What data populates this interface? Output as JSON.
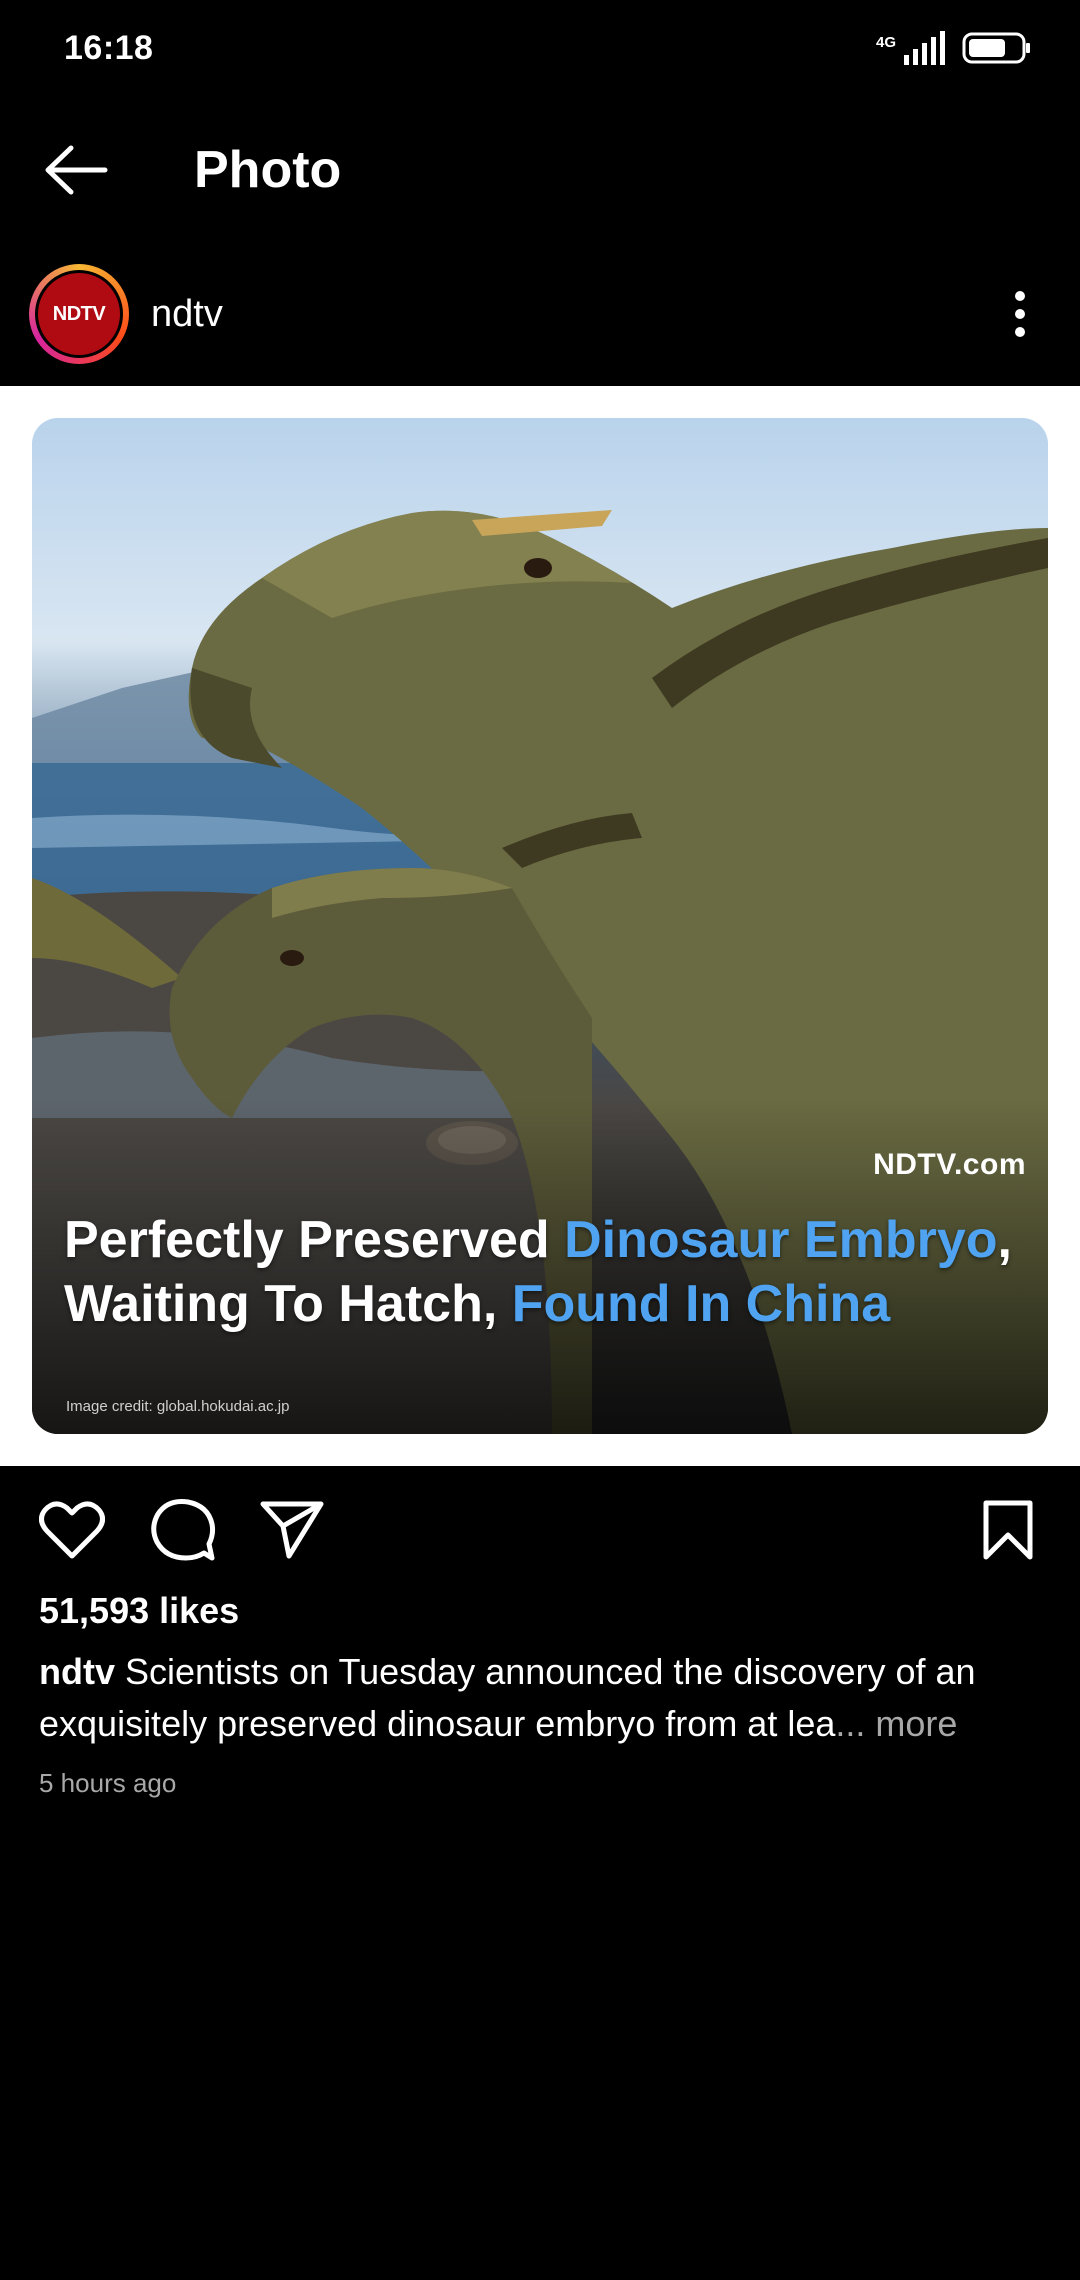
{
  "status_bar": {
    "time": "16:18",
    "network": "4G",
    "icons": [
      "signal-icon",
      "battery-icon"
    ]
  },
  "app_bar": {
    "title": "Photo",
    "back_icon": "arrow-left-icon"
  },
  "post": {
    "username": "ndtv",
    "avatar_text": "NDTV",
    "more_icon": "vertical-dots-icon",
    "image": {
      "watermark": "NDTV.com",
      "headline_parts": [
        {
          "text": "Perfectly Preserved ",
          "highlight": false
        },
        {
          "text": "Dinosaur Embryo",
          "highlight": true
        },
        {
          "text": ", Waiting To Hatch, ",
          "highlight": false
        },
        {
          "text": "Found In China",
          "highlight": true
        }
      ],
      "credit": "Image credit: global.hokudai.ac.jp"
    },
    "actions": {
      "like_icon": "heart-icon",
      "comment_icon": "comment-icon",
      "share_icon": "send-icon",
      "save_icon": "bookmark-icon"
    },
    "likes": "51,593 likes",
    "caption_user": "ndtv",
    "caption_text": " Scientists on Tuesday announced the discovery of an exquisitely preserved dinosaur embryo from at lea",
    "caption_more": "... more",
    "timestamp": "5 hours ago"
  },
  "colors": {
    "background": "#000000",
    "highlight": "#4fa3f0",
    "secondary_text": "#a8a8a8",
    "avatar_red": "#b00b13"
  }
}
